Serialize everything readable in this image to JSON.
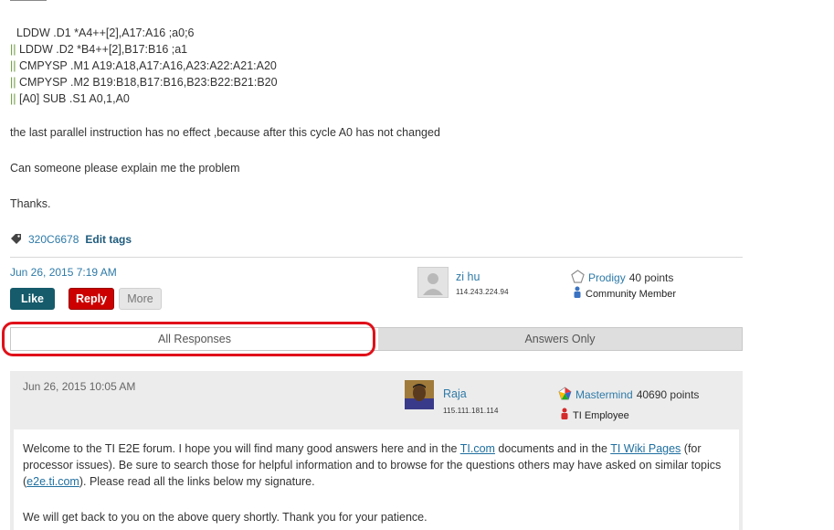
{
  "question": {
    "code_lines": [
      "  LDDW .D1 *A4++[2],A17:A16 ;a0;6",
      "LDDW .D2 *B4++[2],B17:B16 ;a1",
      "CMPYSP .M1 A19:A18,A17:A16,A23:A22:A21:A20",
      "CMPYSP .M2 B19:B18,B17:B16,B23:B22:B21:B20",
      "[A0] SUB .S1 A0,1,A0"
    ],
    "parallel_bar": "||",
    "paragraphs": [
      "the last parallel instruction has no effect ,because after this cycle A0 has not changed",
      "Can someone please explain me the problem",
      "Thanks."
    ],
    "tag": "320C6678",
    "edit_tags": "Edit tags",
    "date": "Jun 26, 2015 7:19 AM",
    "buttons": {
      "like": "Like",
      "reply": "Reply",
      "more": "More"
    },
    "author": {
      "name": "zi hu",
      "ip": "114.243.224.94",
      "rank": "Prodigy",
      "points": "40 points",
      "role": "Community Member"
    }
  },
  "tabs": {
    "all": "All Responses",
    "answers": "Answers Only"
  },
  "reply": {
    "date": "Jun 26, 2015 10:05 AM",
    "author": {
      "name": "Raja",
      "ip": "115.111.181.114",
      "rank": "Mastermind",
      "points": "40690 points",
      "role": "TI Employee"
    },
    "p1": {
      "t1": "Welcome to the TI E2E forum. I hope you will find many good answers here and in the ",
      "link1": "TI.com",
      "t2": " documents and in the ",
      "link2": "TI Wiki Pages",
      "t3": " (for processor issues). Be sure to search those for helpful information and to browse for the questions others may have asked on similar topics (",
      "link3": "e2e.ti.com",
      "t4": "). Please read all the links below my signature."
    },
    "p2": "We will get back to you on the above query shortly. Thank you for your patience."
  },
  "colors": {
    "link": "#2e7aa8",
    "like": "#155b6b",
    "reply": "#cc0000",
    "highlight": "#e0111a"
  },
  "icons": [
    "tag-icon",
    "default-avatar-icon",
    "prodigy-rank-icon",
    "community-member-icon",
    "mastermind-rank-icon",
    "ti-employee-icon",
    "raja-avatar"
  ]
}
